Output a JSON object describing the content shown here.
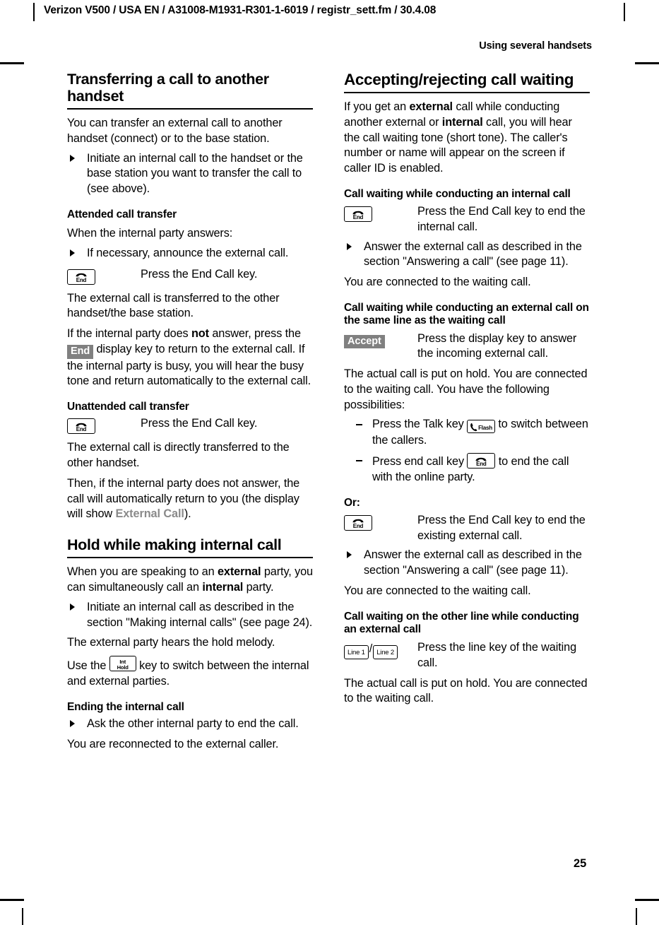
{
  "file_header": "Verizon V500 / USA EN / A31008-M1931-R301-1-6019 / registr_sett.fm / 30.4.08",
  "running_head": "Using several handsets",
  "page_number": "25",
  "icons": {
    "end_call_key_label": "End",
    "int_hold_key_line1": "Int",
    "int_hold_key_line2": "Hold",
    "talk_flash_key_label": "Flash",
    "line1_key_label": "Line 1",
    "line2_key_label": "Line 2",
    "line_separator": "/"
  },
  "colors": {
    "display_key_bg": "#808080",
    "display_key_text": "#ffffff",
    "display_text_gray": "#8a8a8a",
    "rule": "#000000"
  },
  "left_column": {
    "section_title": "Transferring a call to another handset",
    "intro": {
      "part1": "You can transfer an external call to another handset (connect) or to the base station."
    },
    "bullet1": "Initiate an internal call to the handset or the base station you want to transfer the call to (see above).",
    "attended": {
      "heading": "Attended call transfer",
      "lead": "When the internal party answers:",
      "bullet": "If necessary, announce the external call.",
      "key_desc": "Press the End Call key.",
      "after": "The external call is transferred to the other handset/the base station.",
      "not_answer_p1": "If the internal party does ",
      "not_answer_bold": "not",
      "not_answer_p2": " answer, press the ",
      "not_answer_chip": "End",
      "not_answer_p3": " display key to return to the external call. If the internal party is busy, you will hear the busy tone and return automatically to the external call."
    },
    "unattended": {
      "heading": "Unattended call transfer",
      "key_desc": "Press the End Call key.",
      "after": "The external call is directly transferred to the other handset.",
      "then_p1": "Then, if the internal party does not answer, the call will automatically return to you (the display will show ",
      "then_display": "External Call",
      "then_p2": ")."
    },
    "hold": {
      "section_title": "Hold while making internal call",
      "p1_a": "When you are speaking to an ",
      "p1_b_bold": "external",
      "p1_c": " party, you can simultaneously call an ",
      "p1_d_bold": "internal",
      "p1_e": " party.",
      "bullet": "Initiate an internal call as described in the section \"Making internal calls\" (see page 24).",
      "p2": "The external party hears the hold melody.",
      "p3_a": "Use the ",
      "p3_b": " key to switch between the internal and external parties."
    },
    "ending": {
      "heading": "Ending the internal call",
      "bullet": "Ask the other internal party to end the call.",
      "after": "You are reconnected to the external caller."
    }
  },
  "right_column": {
    "section_title": "Accepting/rejecting call waiting",
    "intro_a": "If you get an ",
    "intro_b_bold": "external",
    "intro_c": " call while conducting another external or ",
    "intro_d_bold": "internal",
    "intro_e": " call, you will hear the call waiting tone (short tone). The caller's number or name will appear on the screen if caller ID is enabled.",
    "internal": {
      "heading": "Call waiting while conducting an internal call",
      "key_desc": "Press the End Call key to end the internal call.",
      "bullet": "Answer the external call as described in the section \"Answering a call\" (see page 11).",
      "after": "You are connected to the waiting call."
    },
    "same_line": {
      "heading": "Call waiting while conducting an external call on the same line as the waiting call",
      "accept_chip": "Accept",
      "accept_desc": "Press the display key to answer the incoming external call.",
      "after": "The actual call is put on hold. You are connected to the waiting call. You have the following possibilities:",
      "dash1_a": "Press the Talk key ",
      "dash1_b": " to switch between the callers.",
      "dash2_a": "Press end call key ",
      "dash2_b": " to end the call with the online party."
    },
    "or": {
      "heading": "Or:",
      "key_desc": "Press the End Call key to end the existing external call.",
      "bullet": "Answer the external call as described in the section \"Answering a call\" (see page 11).",
      "after": "You are connected to the waiting call."
    },
    "other_line": {
      "heading": "Call waiting on the other line while conducting an external call",
      "key_desc": "Press the line key of the waiting call.",
      "after": "The actual call is put on hold. You are connected to the waiting call."
    }
  }
}
